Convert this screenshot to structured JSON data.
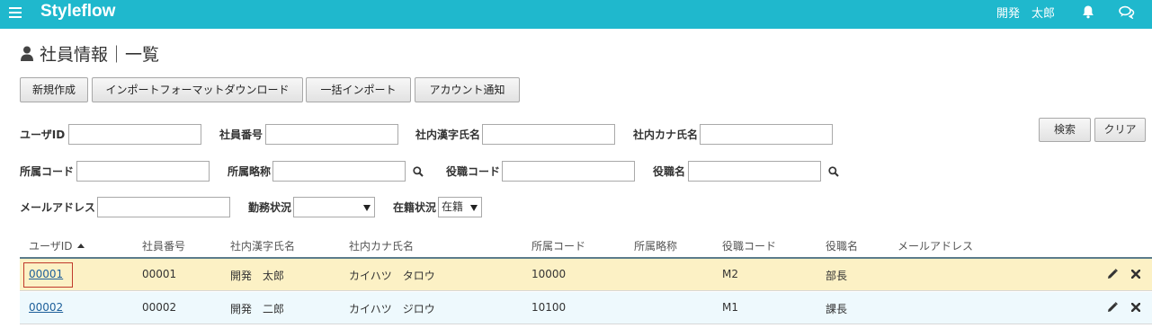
{
  "header": {
    "brand": "Styleflow",
    "user_name": "開発　太郎",
    "bg_color": "#1fb8cd",
    "icons": [
      "menu-icon",
      "bell-icon",
      "chat-icon"
    ]
  },
  "page": {
    "title": "社員情報｜一覧",
    "title_icon": "user-icon"
  },
  "toolbar": {
    "new_label": "新規作成",
    "download_label": "インポートフォーマットダウンロード",
    "bulk_import_label": "一括インポート",
    "notify_label": "アカウント通知"
  },
  "filters": {
    "user_id_label": "ユーザID",
    "employee_no_label": "社員番号",
    "kanji_name_label": "社内漢字氏名",
    "kana_name_label": "社内カナ氏名",
    "dept_code_label": "所属コード",
    "dept_abbr_label": "所属略称",
    "position_code_label": "役職コード",
    "position_name_label": "役職名",
    "email_label": "メールアドレス",
    "work_status_label": "勤務状況",
    "work_status_value": "",
    "enrollment_label": "在籍状況",
    "enrollment_value": "在籍",
    "search_label": "検索",
    "clear_label": "クリア"
  },
  "table": {
    "columns": [
      "ユーザID",
      "社員番号",
      "社内漢字氏名",
      "社内カナ氏名",
      "所属コード",
      "所属略称",
      "役職コード",
      "役職名",
      "メールアドレス"
    ],
    "rows": [
      [
        "00001",
        "00001",
        "開発　太郎",
        "カイハツ　タロウ",
        "10000",
        "",
        "M2",
        "部長",
        ""
      ],
      [
        "00002",
        "00002",
        "開発　二郎",
        "カイハツ　ジロウ",
        "10100",
        "",
        "M1",
        "課長",
        ""
      ]
    ],
    "sorted_column": "ユーザID",
    "sort_direction": "ascending",
    "highlight_color": "#fcf1c5",
    "alt_row_color": "#eef9fd"
  }
}
